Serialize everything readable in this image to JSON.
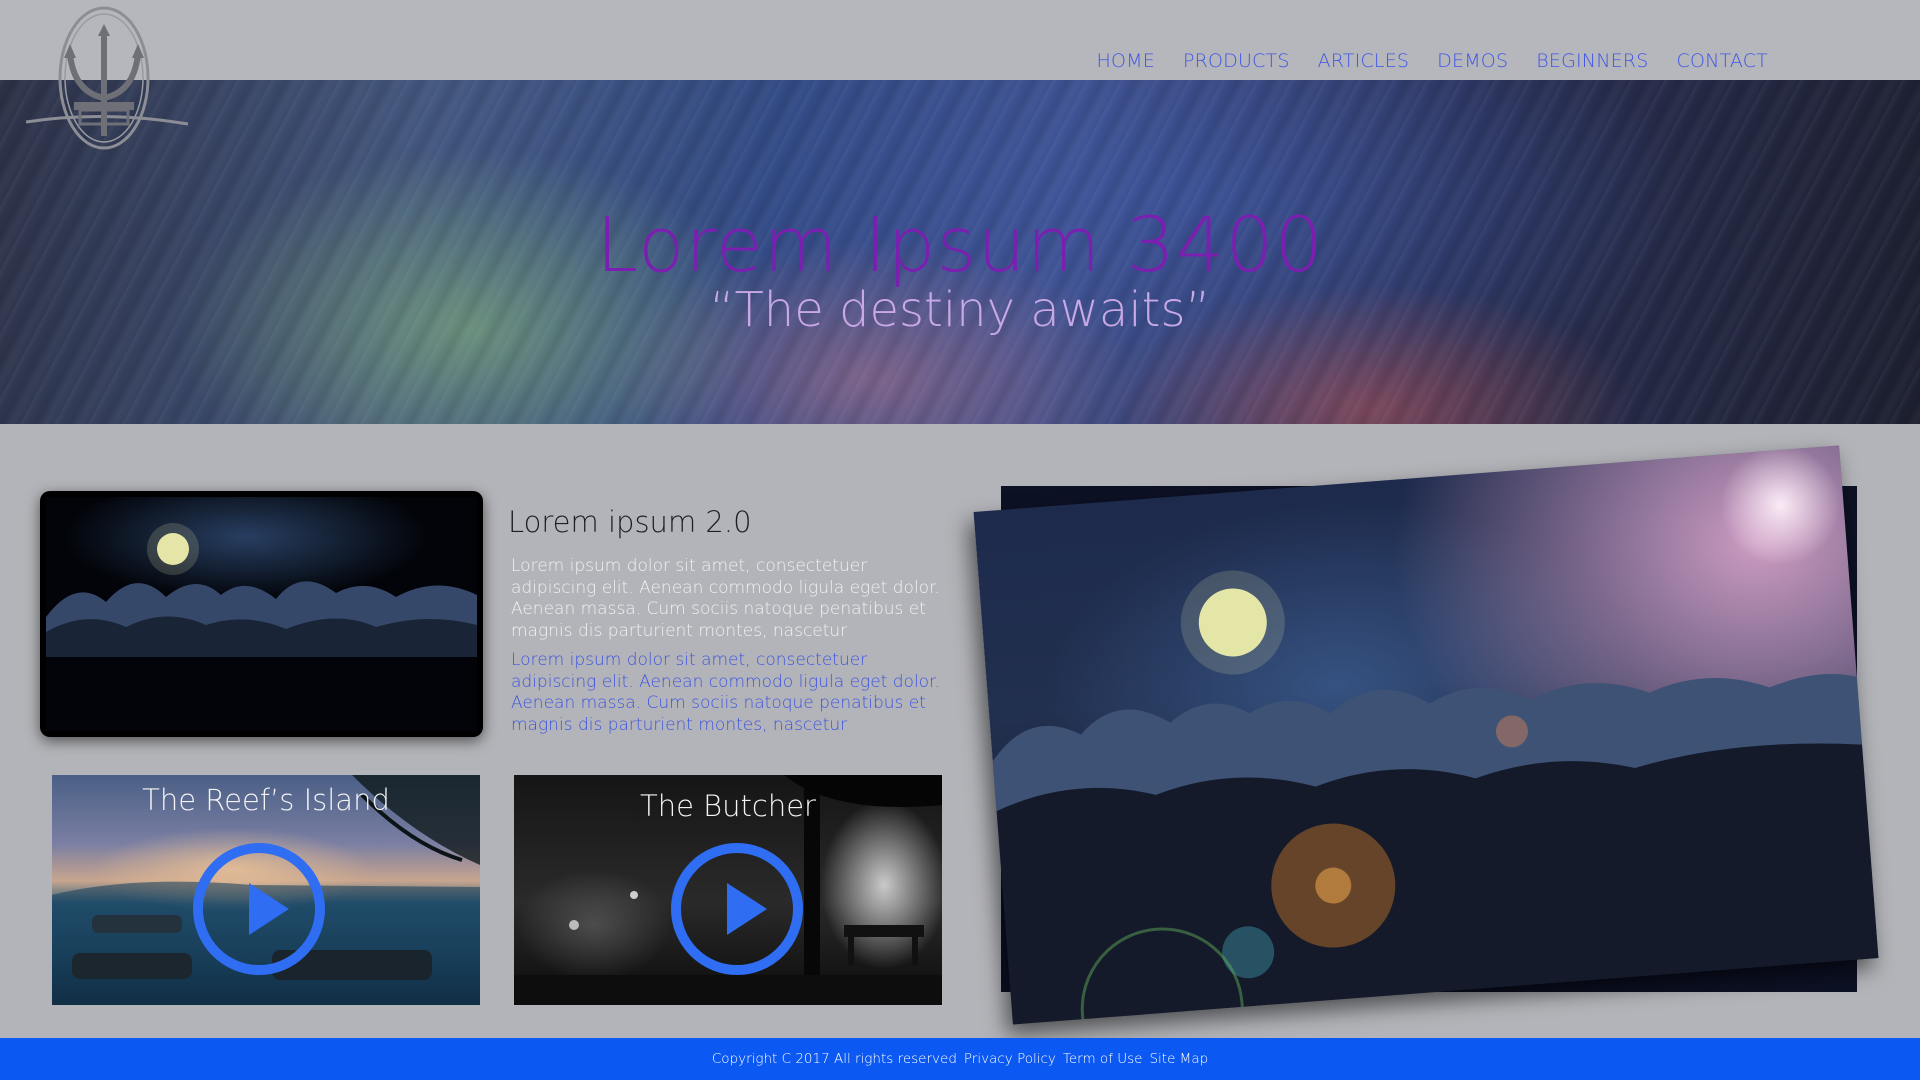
{
  "header": {
    "logo": "trident-logo",
    "nav": [
      {
        "label": "HOME"
      },
      {
        "label": "PRODUCTS"
      },
      {
        "label": "ARTICLES"
      },
      {
        "label": "DEMOS"
      },
      {
        "label": "BEGINNERS"
      },
      {
        "label": "CONTACT"
      }
    ]
  },
  "hero": {
    "title": "Lorem Ipsum 3400",
    "subtitle": "“The destiny awaits”"
  },
  "intro": {
    "title": "Lorem ipsum 2.0",
    "paragraph_white": "Lorem ipsum dolor sit amet, consectetuer adipiscing elit. Aenean commodo ligula eget dolor. Aenean massa. Cum sociis natoque penatibus et magnis dis parturient montes, nascetur",
    "paragraph_blue": "Lorem ipsum dolor sit amet, consectetuer adipiscing elit. Aenean commodo ligula eget dolor. Aenean massa. Cum sociis natoque penatibus et magnis dis parturient montes, nascetur"
  },
  "videos": [
    {
      "title": "The Reef’s Island",
      "icon": "play-icon"
    },
    {
      "title": "The Butcher",
      "icon": "play-icon"
    }
  ],
  "footer": {
    "copyright": "Copyright C 2017  All rights reserved",
    "links": [
      {
        "label": "Privacy Policy"
      },
      {
        "label": "Term of Use"
      },
      {
        "label": "Site Map"
      }
    ]
  },
  "colors": {
    "accent_blue": "#3d55e6",
    "footer_blue": "#0b58f2",
    "hero_title_purple": "#7a1fb0",
    "play_button_blue": "#2f6df2"
  }
}
